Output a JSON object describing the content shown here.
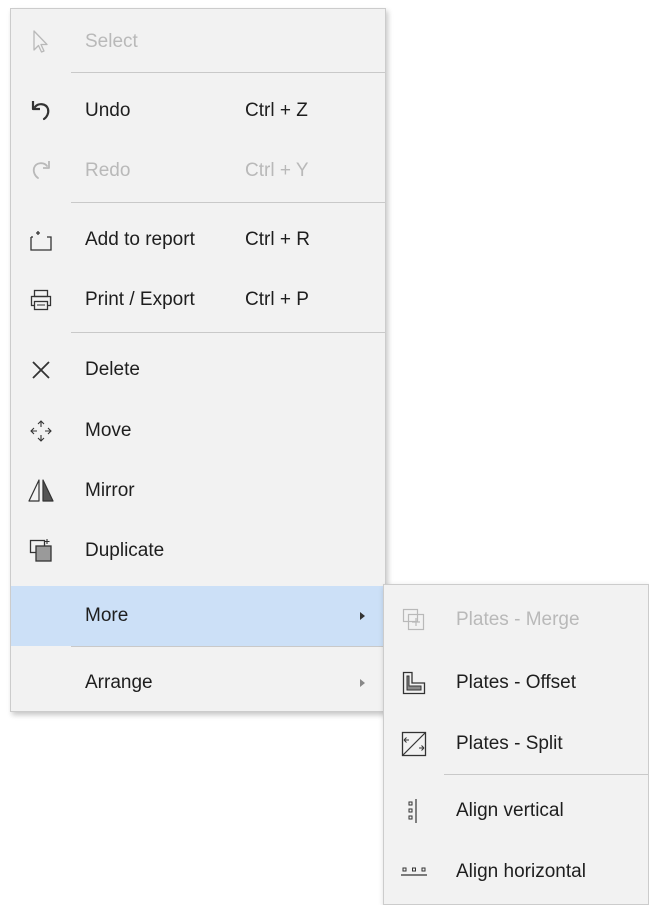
{
  "main_menu": {
    "items": [
      {
        "label": "Select",
        "shortcut": "",
        "icon": "cursor-icon",
        "disabled": true
      },
      {
        "label": "Undo",
        "shortcut": "Ctrl + Z",
        "icon": "undo-icon",
        "disabled": false
      },
      {
        "label": "Redo",
        "shortcut": "Ctrl + Y",
        "icon": "redo-icon",
        "disabled": true
      },
      {
        "label": "Add to report",
        "shortcut": "Ctrl + R",
        "icon": "add-to-report-icon",
        "disabled": false
      },
      {
        "label": "Print / Export",
        "shortcut": "Ctrl + P",
        "icon": "printer-icon",
        "disabled": false
      },
      {
        "label": "Delete",
        "shortcut": "",
        "icon": "close-x-icon",
        "disabled": false
      },
      {
        "label": "Move",
        "shortcut": "",
        "icon": "move-arrows-icon",
        "disabled": false
      },
      {
        "label": "Mirror",
        "shortcut": "",
        "icon": "mirror-icon",
        "disabled": false
      },
      {
        "label": "Duplicate",
        "shortcut": "",
        "icon": "duplicate-icon",
        "disabled": false
      },
      {
        "label": "More",
        "shortcut": "",
        "icon": "",
        "disabled": false,
        "highlighted": true,
        "submenu": true
      },
      {
        "label": "Arrange",
        "shortcut": "",
        "icon": "",
        "disabled": false,
        "submenu": true
      }
    ]
  },
  "sub_menu": {
    "items": [
      {
        "label": "Plates - Merge",
        "icon": "plates-merge-icon",
        "disabled": true
      },
      {
        "label": "Plates - Offset",
        "icon": "plates-offset-icon",
        "disabled": false
      },
      {
        "label": "Plates - Split",
        "icon": "plates-split-icon",
        "disabled": false
      },
      {
        "label": "Align vertical",
        "icon": "align-vertical-icon",
        "disabled": false
      },
      {
        "label": "Align horizontal",
        "icon": "align-horizontal-icon",
        "disabled": false
      }
    ]
  },
  "colors": {
    "menu_background": "#f2f2f2",
    "highlight": "#cce0f7",
    "text": "#1e1e1e",
    "disabled_text": "#b9b9b9",
    "separator": "#c9c9c9"
  }
}
